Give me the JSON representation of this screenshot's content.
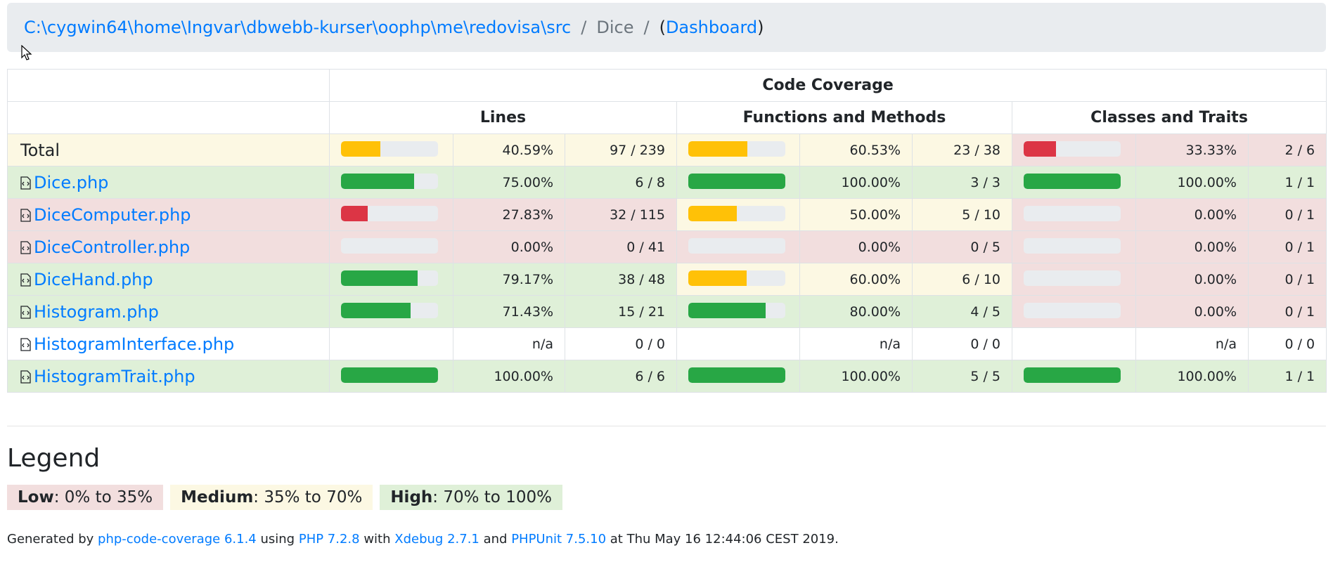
{
  "breadcrumb": {
    "path": "C:\\cygwin64\\home\\Ingvar\\dbwebb-kurser\\oophp\\me\\redovisa\\src",
    "separator": "/",
    "current": "Dice",
    "dashboard_open": "(",
    "dashboard_label": "Dashboard",
    "dashboard_close": ")"
  },
  "table": {
    "title": "Code Coverage",
    "columns": [
      "Lines",
      "Functions and Methods",
      "Classes and Traits"
    ],
    "rows": [
      {
        "name": "Total",
        "is_file": false,
        "lines_pct": "40.59%",
        "lines_frac": "97 / 239",
        "lines_level": "med",
        "lines_bar": 40.59,
        "lines_color": "#ffc107",
        "funcs_pct": "60.53%",
        "funcs_frac": "23 / 38",
        "funcs_level": "med",
        "funcs_bar": 60.53,
        "funcs_color": "#ffc107",
        "classes_pct": "33.33%",
        "classes_frac": "2 / 6",
        "classes_level": "low",
        "classes_bar": 33.33,
        "classes_color": "#dc3545"
      },
      {
        "name": "Dice.php",
        "is_file": true,
        "lines_pct": "75.00%",
        "lines_frac": "6 / 8",
        "lines_level": "high",
        "lines_bar": 75,
        "lines_color": "#28a745",
        "funcs_pct": "100.00%",
        "funcs_frac": "3 / 3",
        "funcs_level": "high",
        "funcs_bar": 100,
        "funcs_color": "#28a745",
        "classes_pct": "100.00%",
        "classes_frac": "1 / 1",
        "classes_level": "high",
        "classes_bar": 100,
        "classes_color": "#28a745"
      },
      {
        "name": "DiceComputer.php",
        "is_file": true,
        "lines_pct": "27.83%",
        "lines_frac": "32 / 115",
        "lines_level": "low",
        "lines_bar": 27.83,
        "lines_color": "#dc3545",
        "funcs_pct": "50.00%",
        "funcs_frac": "5 / 10",
        "funcs_level": "med",
        "funcs_bar": 50,
        "funcs_color": "#ffc107",
        "classes_pct": "0.00%",
        "classes_frac": "0 / 1",
        "classes_level": "low",
        "classes_bar": 0,
        "classes_color": "#dc3545"
      },
      {
        "name": "DiceController.php",
        "is_file": true,
        "lines_pct": "0.00%",
        "lines_frac": "0 / 41",
        "lines_level": "low",
        "lines_bar": 0,
        "lines_color": "#dc3545",
        "funcs_pct": "0.00%",
        "funcs_frac": "0 / 5",
        "funcs_level": "low",
        "funcs_bar": 0,
        "funcs_color": "#dc3545",
        "classes_pct": "0.00%",
        "classes_frac": "0 / 1",
        "classes_level": "low",
        "classes_bar": 0,
        "classes_color": "#dc3545"
      },
      {
        "name": "DiceHand.php",
        "is_file": true,
        "lines_pct": "79.17%",
        "lines_frac": "38 / 48",
        "lines_level": "high",
        "lines_bar": 79.17,
        "lines_color": "#28a745",
        "funcs_pct": "60.00%",
        "funcs_frac": "6 / 10",
        "funcs_level": "med",
        "funcs_bar": 60,
        "funcs_color": "#ffc107",
        "classes_pct": "0.00%",
        "classes_frac": "0 / 1",
        "classes_level": "low",
        "classes_bar": 0,
        "classes_color": "#dc3545"
      },
      {
        "name": "Histogram.php",
        "is_file": true,
        "lines_pct": "71.43%",
        "lines_frac": "15 / 21",
        "lines_level": "high",
        "lines_bar": 71.43,
        "lines_color": "#28a745",
        "funcs_pct": "80.00%",
        "funcs_frac": "4 / 5",
        "funcs_level": "high",
        "funcs_bar": 80,
        "funcs_color": "#28a745",
        "classes_pct": "0.00%",
        "classes_frac": "0 / 1",
        "classes_level": "low",
        "classes_bar": 0,
        "classes_color": "#dc3545"
      },
      {
        "name": "HistogramInterface.php",
        "is_file": true,
        "lines_pct": "n/a",
        "lines_frac": "0 / 0",
        "lines_level": "none",
        "lines_bar": null,
        "lines_color": "",
        "funcs_pct": "n/a",
        "funcs_frac": "0 / 0",
        "funcs_level": "none",
        "funcs_bar": null,
        "funcs_color": "",
        "classes_pct": "n/a",
        "classes_frac": "0 / 0",
        "classes_level": "none",
        "classes_bar": null,
        "classes_color": ""
      },
      {
        "name": "HistogramTrait.php",
        "is_file": true,
        "lines_pct": "100.00%",
        "lines_frac": "6 / 6",
        "lines_level": "high",
        "lines_bar": 100,
        "lines_color": "#28a745",
        "funcs_pct": "100.00%",
        "funcs_frac": "5 / 5",
        "funcs_level": "high",
        "funcs_bar": 100,
        "funcs_color": "#28a745",
        "classes_pct": "100.00%",
        "classes_frac": "1 / 1",
        "classes_level": "high",
        "classes_bar": 100,
        "classes_color": "#28a745"
      }
    ]
  },
  "legend": {
    "title": "Legend",
    "items": [
      {
        "label": "Low",
        "range": ": 0% to 35%",
        "color": "#f2dede"
      },
      {
        "label": "Medium",
        "range": ": 35% to 70%",
        "color": "#fcf8e3"
      },
      {
        "label": "High",
        "range": ": 70% to 100%",
        "color": "#dff0d8"
      }
    ]
  },
  "footer": {
    "prefix": "Generated by ",
    "tool": "php-code-coverage 6.1.4",
    "using": " using ",
    "php": "PHP 7.2.8",
    "with": " with ",
    "xdebug": "Xdebug 2.7.1",
    "and": " and ",
    "phpunit": "PHPUnit 7.5.10",
    "suffix": " at Thu May 16 12:44:06 CEST 2019."
  },
  "colors": {
    "link": "#007bff",
    "low": "#f2dede",
    "medium": "#fcf8e3",
    "high": "#dff0d8",
    "bar_track": "#e9ecef"
  }
}
